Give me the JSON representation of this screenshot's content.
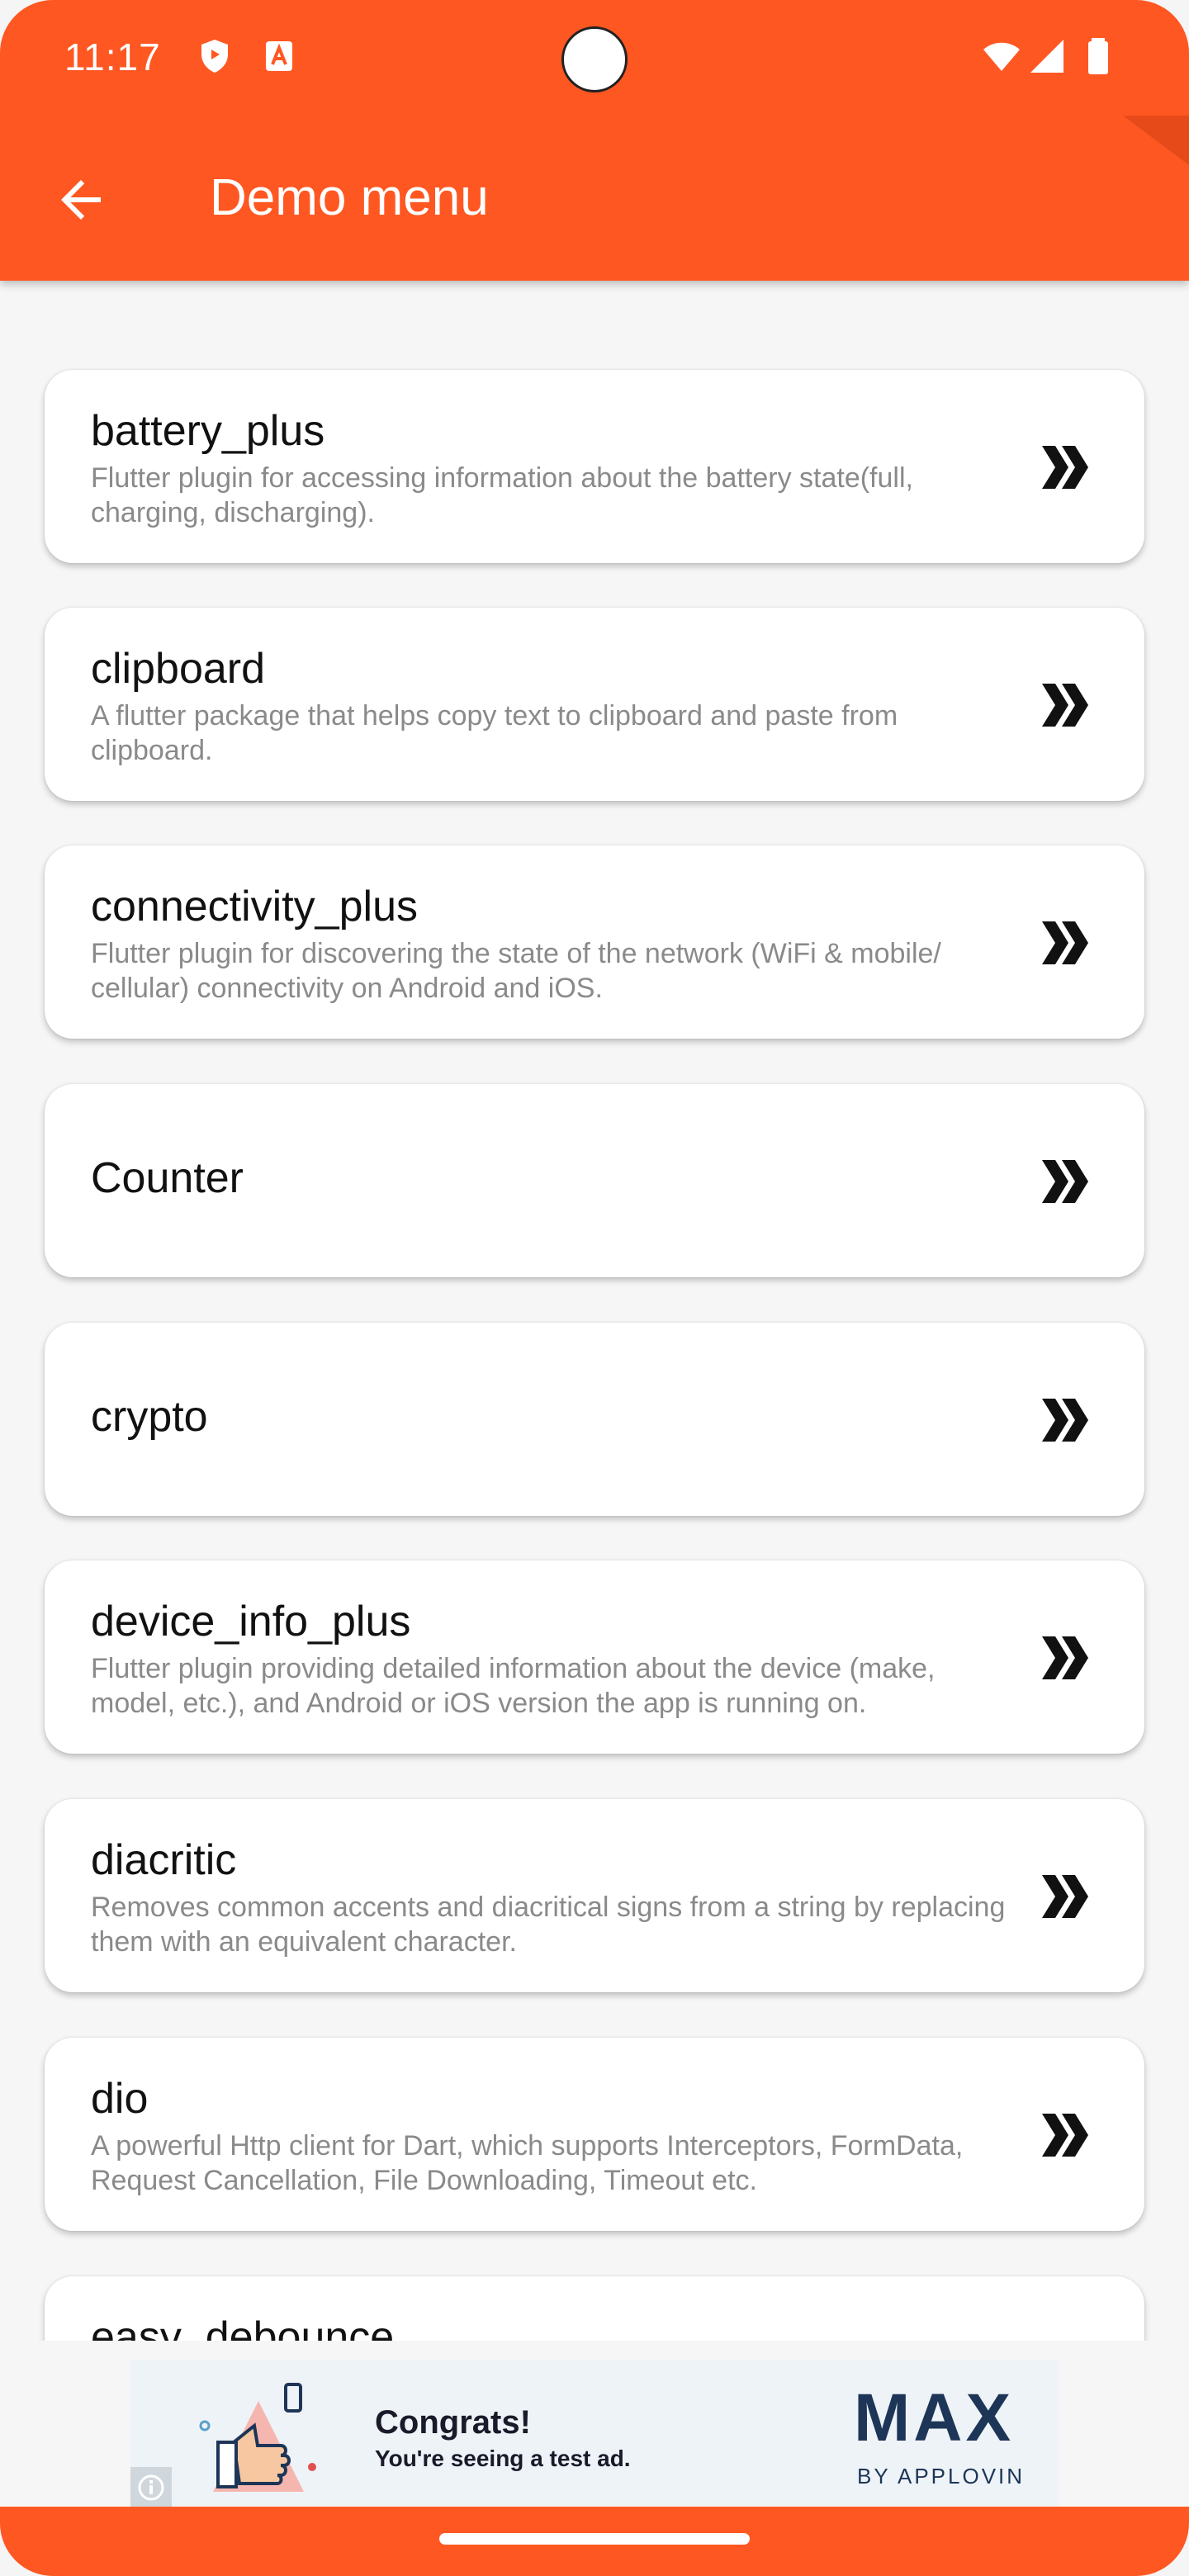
{
  "status_bar": {
    "time": "11:17"
  },
  "appbar": {
    "title": "Demo menu"
  },
  "items": [
    {
      "name": "battery_plus",
      "description": "Flutter plugin for accessing information about the battery state(full, charging, discharging)."
    },
    {
      "name": "clipboard",
      "description": "A flutter package that helps copy text to clipboard and paste from clipboard."
    },
    {
      "name": "connectivity_plus",
      "description": "Flutter plugin for discovering the state of the network (WiFi & mobile/ cellular) connectivity on Android and iOS."
    },
    {
      "name": "Counter",
      "description": ""
    },
    {
      "name": "crypto",
      "description": ""
    },
    {
      "name": "device_info_plus",
      "description": "Flutter plugin providing detailed information about the device (make, model, etc.), and Android or iOS version the app is running on."
    },
    {
      "name": "diacritic",
      "description": "Removes common accents and diacritical signs from a string by replacing them with an equivalent character."
    },
    {
      "name": "dio",
      "description": "A powerful Http client for Dart, which supports Interceptors, FormData, Request Cancellation, File Downloading, Timeout etc."
    },
    {
      "name": "easy_debounce",
      "description": ""
    }
  ],
  "ad": {
    "headline": "Congrats!",
    "subtext": "You're seeing a test ad.",
    "brand": "MAX",
    "brand_sub": "BY APPLOVIN"
  },
  "colors": {
    "accent": "#ff5722",
    "background": "#f6f6f6",
    "card": "#ffffff",
    "description": "#8a8a8a"
  },
  "icons": {
    "back": "arrow-back-icon",
    "item": "double-chevron-right-icon"
  }
}
